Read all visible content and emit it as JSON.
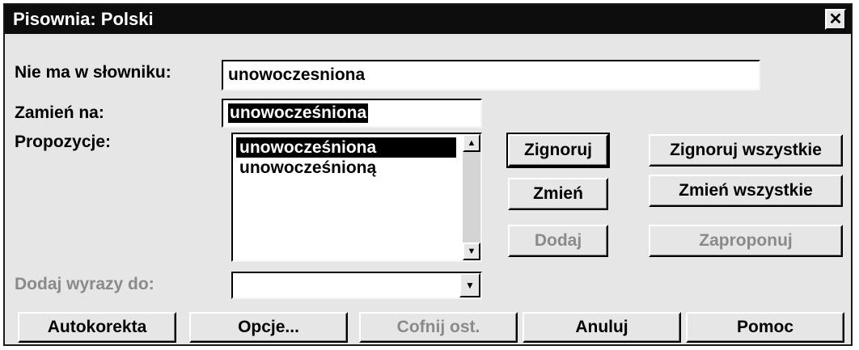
{
  "window": {
    "title": "Pisownia: Polski",
    "close_glyph": "✕"
  },
  "fields": {
    "not_in_dictionary_label": "Nie ma w słowniku:",
    "not_in_dictionary_value": "unowoczesniona",
    "replace_with_label": "Zamień na:",
    "replace_with_value": "unowocześniona",
    "suggestions_label": "Propozycje:",
    "add_words_to_label": "Dodaj wyrazy do:",
    "add_words_to_value": ""
  },
  "suggestions": [
    {
      "text": "unowocześniona",
      "selected": true
    },
    {
      "text": "unowocześnioną",
      "selected": false
    }
  ],
  "buttons": {
    "ignore": "Zignoruj",
    "ignore_all": "Zignoruj wszystkie",
    "change": "Zmień",
    "change_all": "Zmień wszystkie",
    "add": "Dodaj",
    "suggest": "Zaproponuj",
    "autocorrect": "Autokorekta",
    "options": "Opcje...",
    "undo_last": "Cofnij ost.",
    "cancel": "Anuluj",
    "help": "Pomoc"
  },
  "icons": {
    "scroll_up": "▲",
    "scroll_down": "▼",
    "dropdown": "▼"
  }
}
